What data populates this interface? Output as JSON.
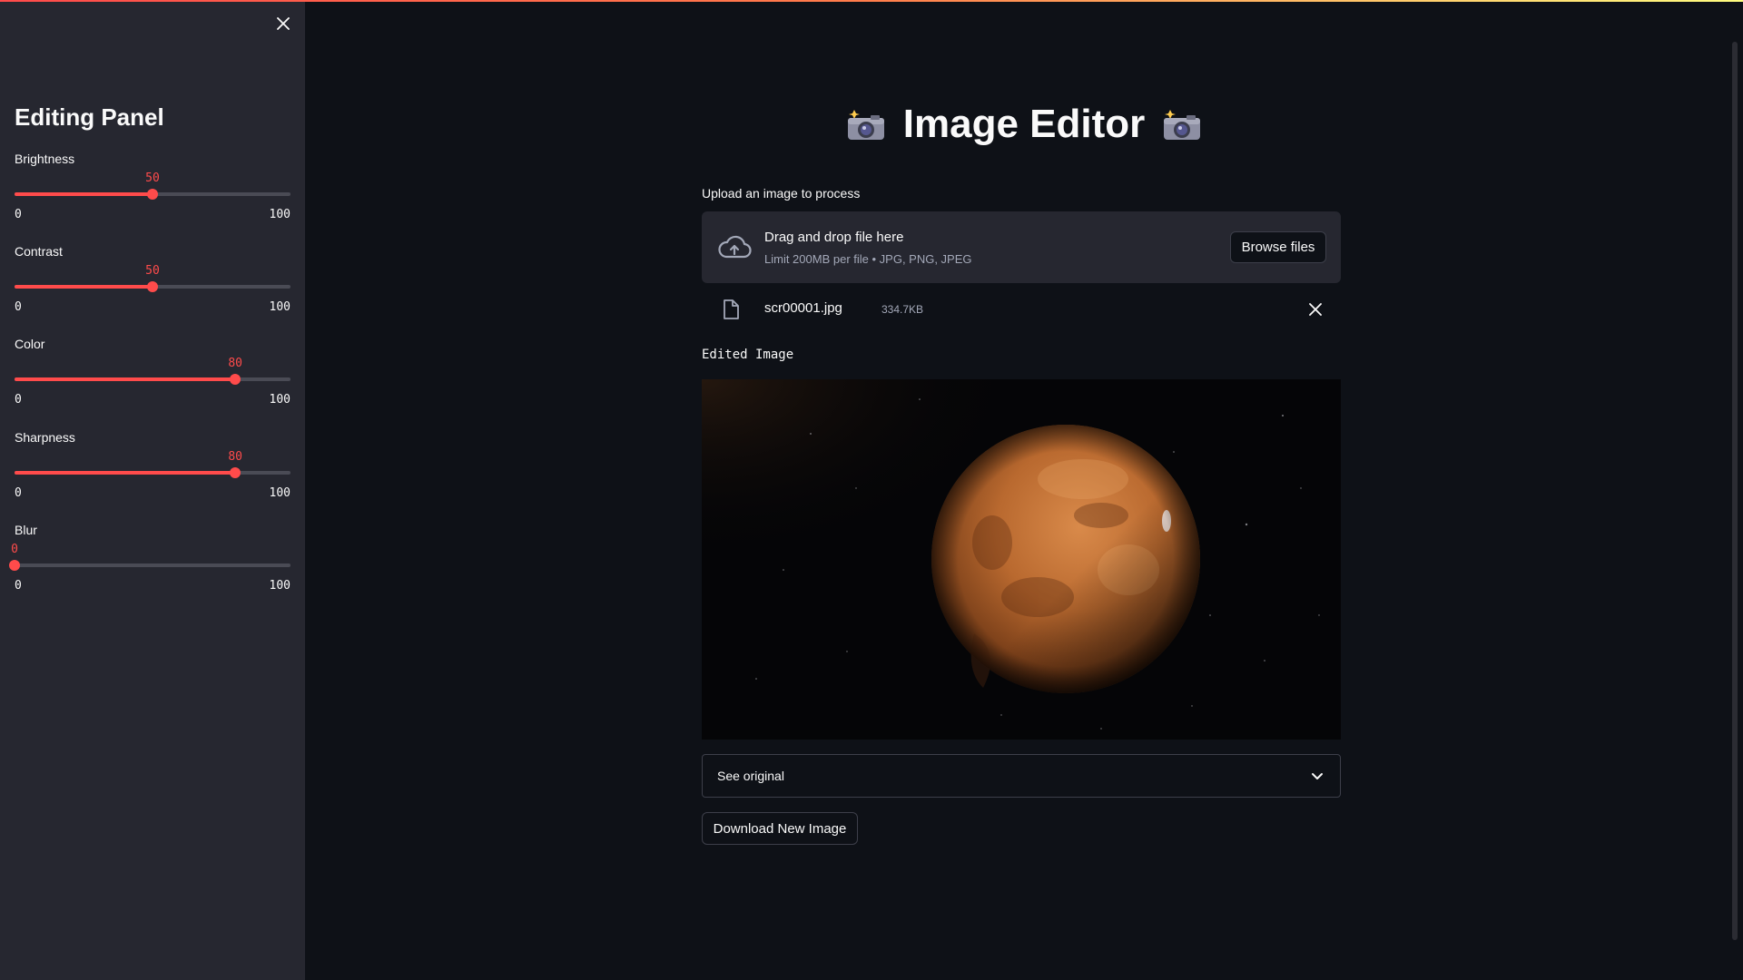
{
  "colors": {
    "accent": "#ff4b4b",
    "sidebar_bg": "#262730",
    "main_bg": "#0e1117"
  },
  "sidebar": {
    "title": "Editing Panel",
    "close_icon": "close-icon",
    "sliders": [
      {
        "label": "Brightness",
        "value": "50",
        "min": "0",
        "max": "100"
      },
      {
        "label": "Contrast",
        "value": "50",
        "min": "0",
        "max": "100"
      },
      {
        "label": "Color",
        "value": "80",
        "min": "0",
        "max": "100"
      },
      {
        "label": "Sharpness",
        "value": "80",
        "min": "0",
        "max": "100"
      },
      {
        "label": "Blur",
        "value": "0",
        "min": "0",
        "max": "100"
      }
    ]
  },
  "main": {
    "title": "Image Editor",
    "title_icon": "camera-with-flash-icon",
    "uploader": {
      "label": "Upload an image to process",
      "drop_text": "Drag and drop file here",
      "limit_text": "Limit 200MB per file • JPG, PNG, JPEG",
      "browse_label": "Browse files",
      "upload_icon": "cloud-upload-icon"
    },
    "file": {
      "name": "scr00001.jpg",
      "size": "334.7KB",
      "icon": "file-icon"
    },
    "image_caption": "Edited Image",
    "expander_label": "See original",
    "download_label": "Download New Image"
  }
}
